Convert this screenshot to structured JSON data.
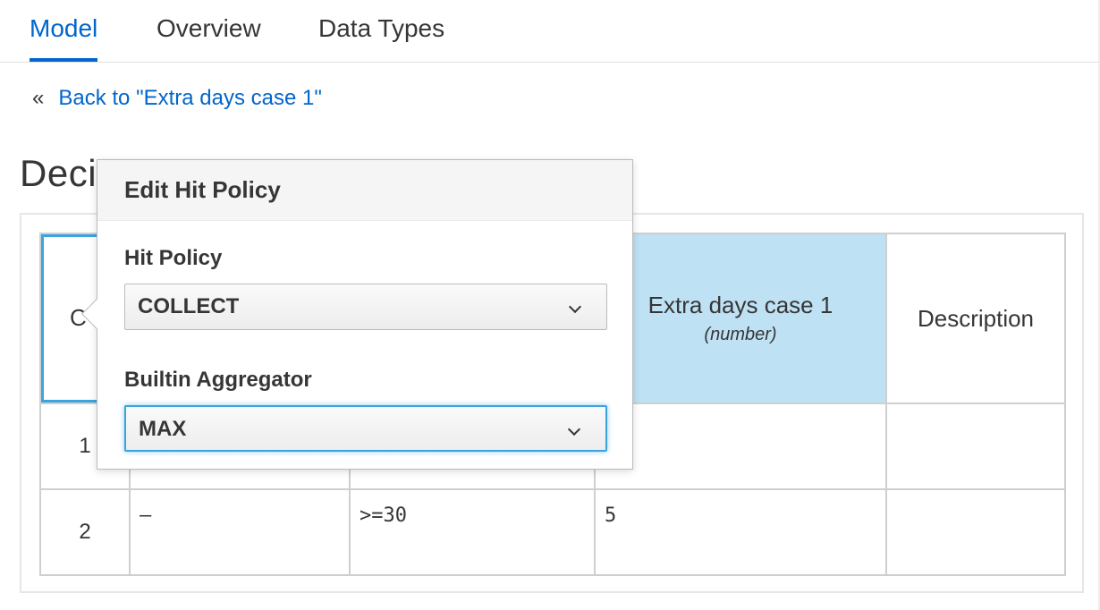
{
  "tabs": [
    {
      "label": "Model",
      "active": true
    },
    {
      "label": "Overview",
      "active": false
    },
    {
      "label": "Data Types",
      "active": false
    }
  ],
  "back": {
    "chevron": "«",
    "label": "Back to \"Extra days case 1\""
  },
  "page_title": "Deci",
  "table": {
    "hit_policy_cell": "C",
    "output_column": {
      "name": "Extra days case 1",
      "type": "(number)"
    },
    "description_header": "Description",
    "rows": [
      {
        "num": "1",
        "in1": "",
        "in2": "",
        "out": "",
        "desc": ""
      },
      {
        "num": "2",
        "in1": "–",
        "in2": ">=30",
        "out": "5",
        "desc": ""
      }
    ]
  },
  "popover": {
    "title": "Edit Hit Policy",
    "hit_policy_label": "Hit Policy",
    "hit_policy_value": "COLLECT",
    "aggregator_label": "Builtin Aggregator",
    "aggregator_value": "MAX"
  },
  "colors": {
    "accent": "#0066cc",
    "output_header_bg": "#bee1f4",
    "focus": "#39a5dc"
  },
  "icons": {
    "back": "double-chevron-left-icon",
    "dropdown": "chevron-down-icon"
  }
}
